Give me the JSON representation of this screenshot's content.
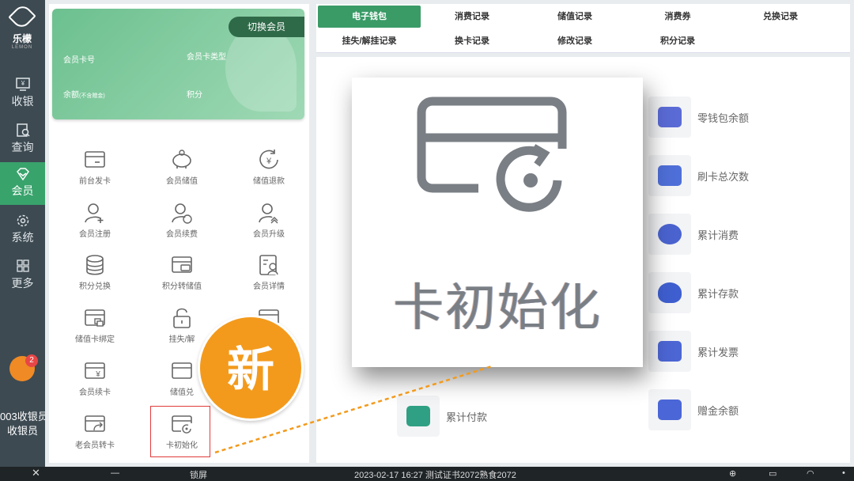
{
  "logo": {
    "name": "乐檬",
    "sub": "LEMON"
  },
  "nav": [
    {
      "label": "收银",
      "icon": "cashier-icon"
    },
    {
      "label": "查询",
      "icon": "query-icon"
    },
    {
      "label": "会员",
      "icon": "member-icon"
    },
    {
      "label": "系统",
      "icon": "gear-icon"
    },
    {
      "label": "更多",
      "icon": "grid-icon"
    }
  ],
  "notification_count": "2",
  "cashier": {
    "id": "003收银员",
    "name": "收银员"
  },
  "card": {
    "switch_label": "切换会员",
    "card_no_label": "会员卡号",
    "card_type_label": "会员卡类型",
    "balance_label": "余额",
    "balance_note": "(不含赠金)",
    "points_label": "积分"
  },
  "functions": [
    {
      "label": "前台发卡",
      "icon": "card-icon"
    },
    {
      "label": "会员储值",
      "icon": "piggy-bank-icon"
    },
    {
      "label": "储值退款",
      "icon": "yuan-refund-icon"
    },
    {
      "label": "会员注册",
      "icon": "user-add-icon"
    },
    {
      "label": "会员续费",
      "icon": "user-renew-icon"
    },
    {
      "label": "会员升级",
      "icon": "user-upgrade-icon"
    },
    {
      "label": "积分兑换",
      "icon": "coins-icon"
    },
    {
      "label": "积分转储值",
      "icon": "points-transfer-icon"
    },
    {
      "label": "会员详情",
      "icon": "member-detail-icon"
    },
    {
      "label": "储值卡绑定",
      "icon": "card-bind-icon"
    },
    {
      "label": "挂失/解",
      "icon": "lock-icon"
    },
    {
      "label": "",
      "icon": "card-icon"
    },
    {
      "label": "会员续卡",
      "icon": "card-renew-icon"
    },
    {
      "label": "储值兑",
      "icon": "card-exchange-icon"
    },
    {
      "label": "老会员转卡",
      "icon": "card-transfer-icon"
    },
    {
      "label": "卡初始化",
      "icon": "card-reset-icon"
    }
  ],
  "tabs_row1": [
    "电子钱包",
    "消费记录",
    "储值记录",
    "消费券",
    "兑换记录"
  ],
  "tabs_row2": [
    "挂失/解挂记录",
    "换卡记录",
    "修改记录",
    "积分记录"
  ],
  "stats": [
    {
      "label": "零钱包余额",
      "icon": "wallet-icon",
      "color": "#5b6bd6"
    },
    {
      "label": "刷卡总次数",
      "icon": "card-swipe-icon",
      "color": "#4f6fd8"
    },
    {
      "label": "累计消费",
      "icon": "chart-icon",
      "color": "#4a63cf"
    },
    {
      "label": "累计存款",
      "icon": "piggy-bank-icon",
      "color": "#3f5fd0"
    },
    {
      "label": "累计发票",
      "icon": "invoice-icon",
      "color": "#4c66d4"
    },
    {
      "label": "累计付款",
      "icon": "payment-icon",
      "color": "#2fa083"
    },
    {
      "label": "赠金余额",
      "icon": "gift-icon",
      "color": "#4b66d6"
    }
  ],
  "zoom": {
    "label": "卡初始化",
    "icon": "card-reset-icon"
  },
  "new_badge": "新",
  "taskbar": {
    "lock": "锁屏",
    "status": "2023-02-17 16:27  测试证书2072熟食2072"
  }
}
